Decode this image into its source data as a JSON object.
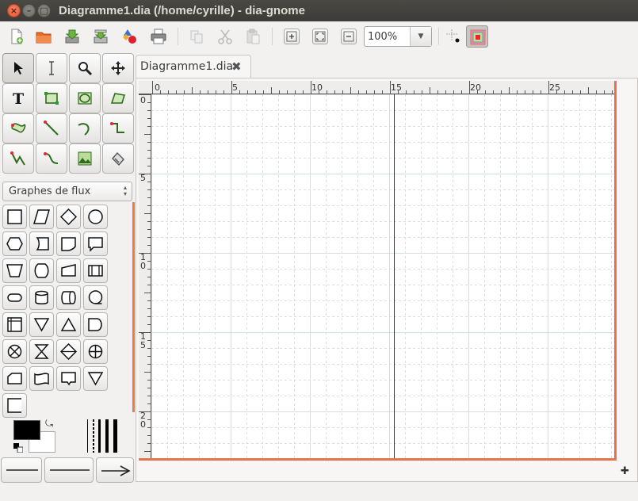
{
  "window": {
    "title": "Diagramme1.dia (/home/cyrille) - dia-gnome",
    "close_glyph": "×",
    "minimize_glyph": "–",
    "maximize_glyph": "□"
  },
  "toolbar": {
    "zoom_value": "100%",
    "zoom_dropdown_glyph": "▼",
    "icons": [
      "new-diagram-icon",
      "open-icon",
      "save-icon",
      "save-as-icon",
      "export-icon",
      "print-icon",
      "copy-icon",
      "cut-icon",
      "paste-icon",
      "zoom-in-icon",
      "zoom-fit-icon",
      "zoom-out-icon",
      "snap-to-grid-icon",
      "snap-to-objects-icon"
    ]
  },
  "toolbox": {
    "tools": [
      "pointer-tool-icon",
      "text-edit-tool-icon",
      "magnify-tool-icon",
      "scroll-tool-icon",
      "text-tool-icon",
      "box-tool-icon",
      "ellipse-tool-icon",
      "polygon-tool-icon",
      "beziergon-tool-icon",
      "line-tool-icon",
      "arc-tool-icon",
      "zigzagline-tool-icon",
      "polyline-tool-icon",
      "bezierline-tool-icon",
      "image-tool-icon",
      "outline-tool-icon"
    ],
    "text_tool_glyph": "T",
    "sheet_name": "Graphes de flux",
    "sheet_arrow_up": "▴",
    "sheet_arrow_down": "▾",
    "swap_glyph": "⤿",
    "shapes": [
      "process",
      "input-output",
      "decision",
      "connector",
      "preparation",
      "punched-card",
      "document",
      "stored-data",
      "manual-operation",
      "terminal-hexagon",
      "card",
      "predefined-process",
      "terminal",
      "magnetic-disk",
      "direct-access-storage",
      "sequential-storage",
      "internal-storage",
      "extract",
      "merge",
      "delay",
      "summing-junction",
      "collate",
      "sort",
      "or-junction",
      "manual-input",
      "punched-tape",
      "offline-storage",
      "transfer",
      "annotation"
    ]
  },
  "document": {
    "tab_label": "Diagramme1.dia",
    "tab_close_glyph": "✖",
    "nav_glyph": "✚",
    "hruler_labels": [
      "0",
      "5",
      "10",
      "15",
      "20",
      "25"
    ],
    "vruler_labels": [
      "0",
      "5",
      "10",
      "15",
      "20"
    ]
  },
  "colors": {
    "accent": "#e7734a",
    "page_guide": "#1f2f8c",
    "foreground": "#000000",
    "background": "#ffffff"
  }
}
